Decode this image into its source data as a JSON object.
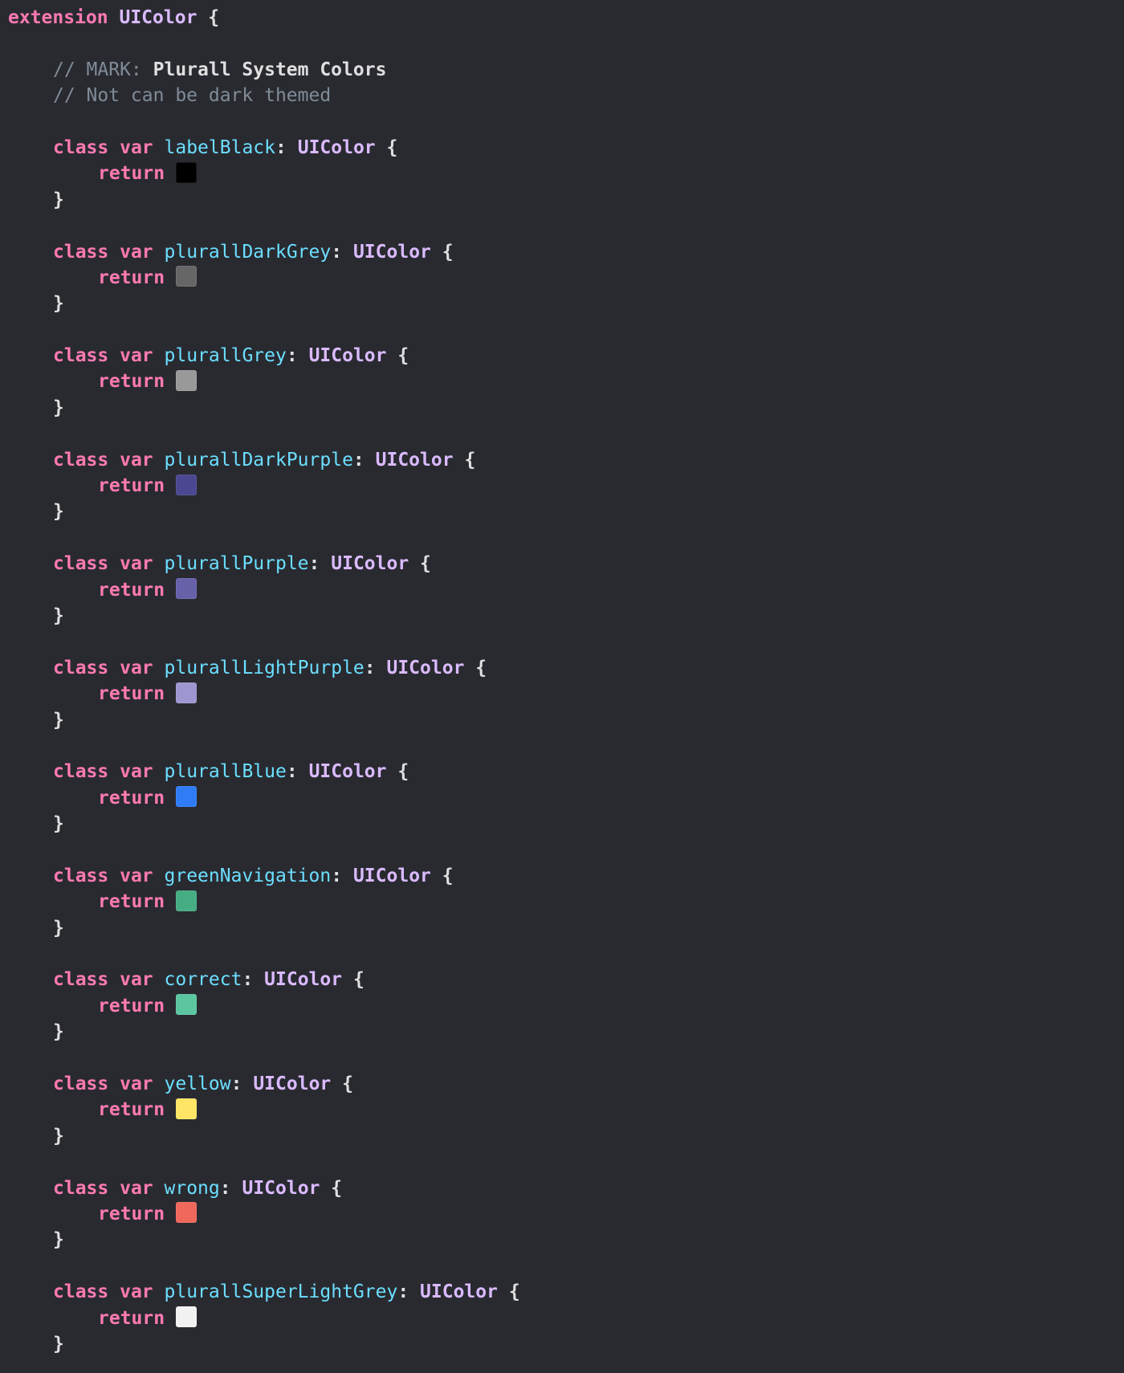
{
  "extension": {
    "keyword": "extension",
    "type": "UIColor",
    "open_brace": "{"
  },
  "comments": {
    "mark_prefix": "// MARK: ",
    "mark_title": "Plurall System Colors",
    "note": "// Not can be dark themed"
  },
  "syntax": {
    "class_kw": "class",
    "var_kw": "var",
    "colon": ":",
    "type": "UIColor",
    "open_brace": "{",
    "return_kw": "return",
    "close_brace": "}"
  },
  "colors": [
    {
      "name": "labelBlack",
      "swatch": "#000000"
    },
    {
      "name": "plurallDarkGrey",
      "swatch": "#666666"
    },
    {
      "name": "plurallGrey",
      "swatch": "#999999"
    },
    {
      "name": "plurallDarkPurple",
      "swatch": "#4b4790"
    },
    {
      "name": "plurallPurple",
      "swatch": "#6761aa"
    },
    {
      "name": "plurallLightPurple",
      "swatch": "#9c97d0"
    },
    {
      "name": "plurallBlue",
      "swatch": "#2f7cf6"
    },
    {
      "name": "greenNavigation",
      "swatch": "#46ac84"
    },
    {
      "name": "correct",
      "swatch": "#5bc6a0"
    },
    {
      "name": "yellow",
      "swatch": "#ffe565"
    },
    {
      "name": "wrong",
      "swatch": "#f0685c"
    },
    {
      "name": "plurallSuperLightGrey",
      "swatch": "#f1f1f1"
    }
  ]
}
